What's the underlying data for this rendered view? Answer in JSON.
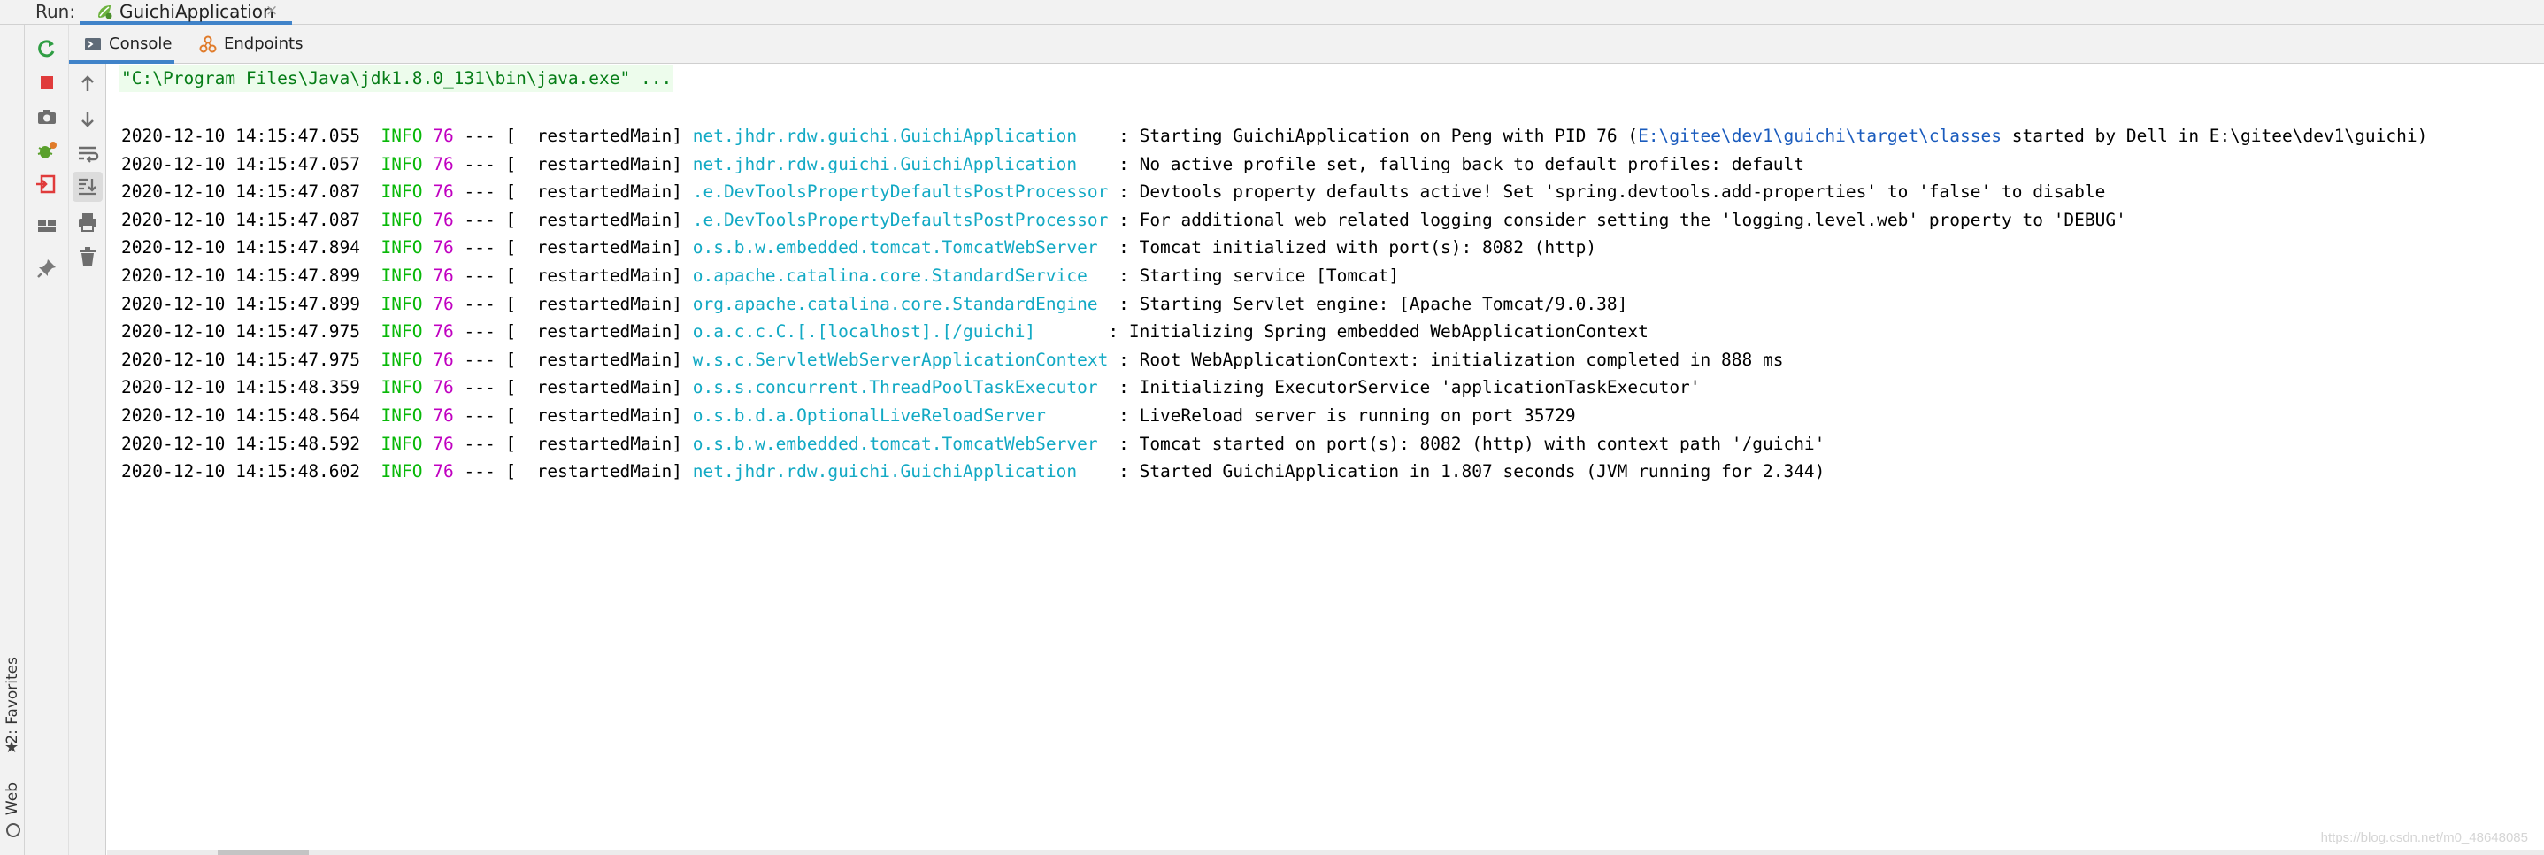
{
  "run_bar": {
    "label": "Run:",
    "tab_label": "GuichiApplication",
    "close_glyph": "×"
  },
  "subtabs": [
    {
      "label": "Console",
      "icon": "console-icon",
      "active": true
    },
    {
      "label": "Endpoints",
      "icon": "endpoints-icon",
      "active": false
    }
  ],
  "left_strip": {
    "favorites_label": "2: Favorites",
    "web_label": "Web"
  },
  "toolbar": {
    "rerun": "rerun-icon",
    "stop": "stop-icon",
    "screenshot": "camera-icon",
    "debug_rerun": "debug-rerun-icon",
    "exit": "exit-icon",
    "layout": "layout-icon",
    "pin": "pin-icon",
    "up": "arrow-up-icon",
    "down": "arrow-down-icon",
    "soft_wrap": "soft-wrap-icon",
    "scroll_to_end": "scroll-to-end-icon",
    "print": "print-icon",
    "clear": "trash-icon"
  },
  "console": {
    "command": "\"C:\\Program Files\\Java\\jdk1.8.0_131\\bin\\java.exe\" ...",
    "lines": [
      {
        "ts": "2020-12-10 14:15:47.055",
        "level": "INFO",
        "pid": "76",
        "sep": " --- [  restartedMain] ",
        "logger": "net.jhdr.rdw.guichi.GuichiApplication    ",
        "msg": ": Starting GuichiApplication on Peng with PID 76 (",
        "link": "E:\\gitee\\dev1\\guichi\\target\\classes",
        "msg2": " started by Dell in E:\\gitee\\dev1\\guichi)"
      },
      {
        "ts": "2020-12-10 14:15:47.057",
        "level": "INFO",
        "pid": "76",
        "sep": " --- [  restartedMain] ",
        "logger": "net.jhdr.rdw.guichi.GuichiApplication    ",
        "msg": ": No active profile set, falling back to default profiles: default",
        "link": "",
        "msg2": ""
      },
      {
        "ts": "2020-12-10 14:15:47.087",
        "level": "INFO",
        "pid": "76",
        "sep": " --- [  restartedMain] ",
        "logger": ".e.DevToolsPropertyDefaultsPostProcessor ",
        "msg": ": Devtools property defaults active! Set 'spring.devtools.add-properties' to 'false' to disable",
        "link": "",
        "msg2": ""
      },
      {
        "ts": "2020-12-10 14:15:47.087",
        "level": "INFO",
        "pid": "76",
        "sep": " --- [  restartedMain] ",
        "logger": ".e.DevToolsPropertyDefaultsPostProcessor ",
        "msg": ": For additional web related logging consider setting the 'logging.level.web' property to 'DEBUG'",
        "link": "",
        "msg2": ""
      },
      {
        "ts": "2020-12-10 14:15:47.894",
        "level": "INFO",
        "pid": "76",
        "sep": " --- [  restartedMain] ",
        "logger": "o.s.b.w.embedded.tomcat.TomcatWebServer  ",
        "msg": ": Tomcat initialized with port(s): 8082 (http)",
        "link": "",
        "msg2": ""
      },
      {
        "ts": "2020-12-10 14:15:47.899",
        "level": "INFO",
        "pid": "76",
        "sep": " --- [  restartedMain] ",
        "logger": "o.apache.catalina.core.StandardService   ",
        "msg": ": Starting service [Tomcat]",
        "link": "",
        "msg2": ""
      },
      {
        "ts": "2020-12-10 14:15:47.899",
        "level": "INFO",
        "pid": "76",
        "sep": " --- [  restartedMain] ",
        "logger": "org.apache.catalina.core.StandardEngine  ",
        "msg": ": Starting Servlet engine: [Apache Tomcat/9.0.38]",
        "link": "",
        "msg2": ""
      },
      {
        "ts": "2020-12-10 14:15:47.975",
        "level": "INFO",
        "pid": "76",
        "sep": " --- [  restartedMain] ",
        "logger": "o.a.c.c.C.[.[localhost].[/guichi]       ",
        "msg": ": Initializing Spring embedded WebApplicationContext",
        "link": "",
        "msg2": ""
      },
      {
        "ts": "2020-12-10 14:15:47.975",
        "level": "INFO",
        "pid": "76",
        "sep": " --- [  restartedMain] ",
        "logger": "w.s.c.ServletWebServerApplicationContext ",
        "msg": ": Root WebApplicationContext: initialization completed in 888 ms",
        "link": "",
        "msg2": ""
      },
      {
        "ts": "2020-12-10 14:15:48.359",
        "level": "INFO",
        "pid": "76",
        "sep": " --- [  restartedMain] ",
        "logger": "o.s.s.concurrent.ThreadPoolTaskExecutor  ",
        "msg": ": Initializing ExecutorService 'applicationTaskExecutor'",
        "link": "",
        "msg2": ""
      },
      {
        "ts": "2020-12-10 14:15:48.564",
        "level": "INFO",
        "pid": "76",
        "sep": " --- [  restartedMain] ",
        "logger": "o.s.b.d.a.OptionalLiveReloadServer       ",
        "msg": ": LiveReload server is running on port 35729",
        "link": "",
        "msg2": ""
      },
      {
        "ts": "2020-12-10 14:15:48.592",
        "level": "INFO",
        "pid": "76",
        "sep": " --- [  restartedMain] ",
        "logger": "o.s.b.w.embedded.tomcat.TomcatWebServer  ",
        "msg": ": Tomcat started on port(s): 8082 (http) with context path '/guichi'",
        "link": "",
        "msg2": ""
      },
      {
        "ts": "2020-12-10 14:15:48.602",
        "level": "INFO",
        "pid": "76",
        "sep": " --- [  restartedMain] ",
        "logger": "net.jhdr.rdw.guichi.GuichiApplication    ",
        "msg": ": Started GuichiApplication in 1.807 seconds (JVM running for 2.344)",
        "link": "",
        "msg2": ""
      }
    ]
  },
  "watermark": "https://blog.csdn.net/m0_48648085",
  "colors": {
    "accent_tab": "#4083c9",
    "info_level": "#08b808",
    "pid": "#c000c0",
    "logger": "#12a9c4",
    "command_text": "#067d17",
    "command_bg": "#edfcec",
    "link": "#1a5bbd"
  }
}
